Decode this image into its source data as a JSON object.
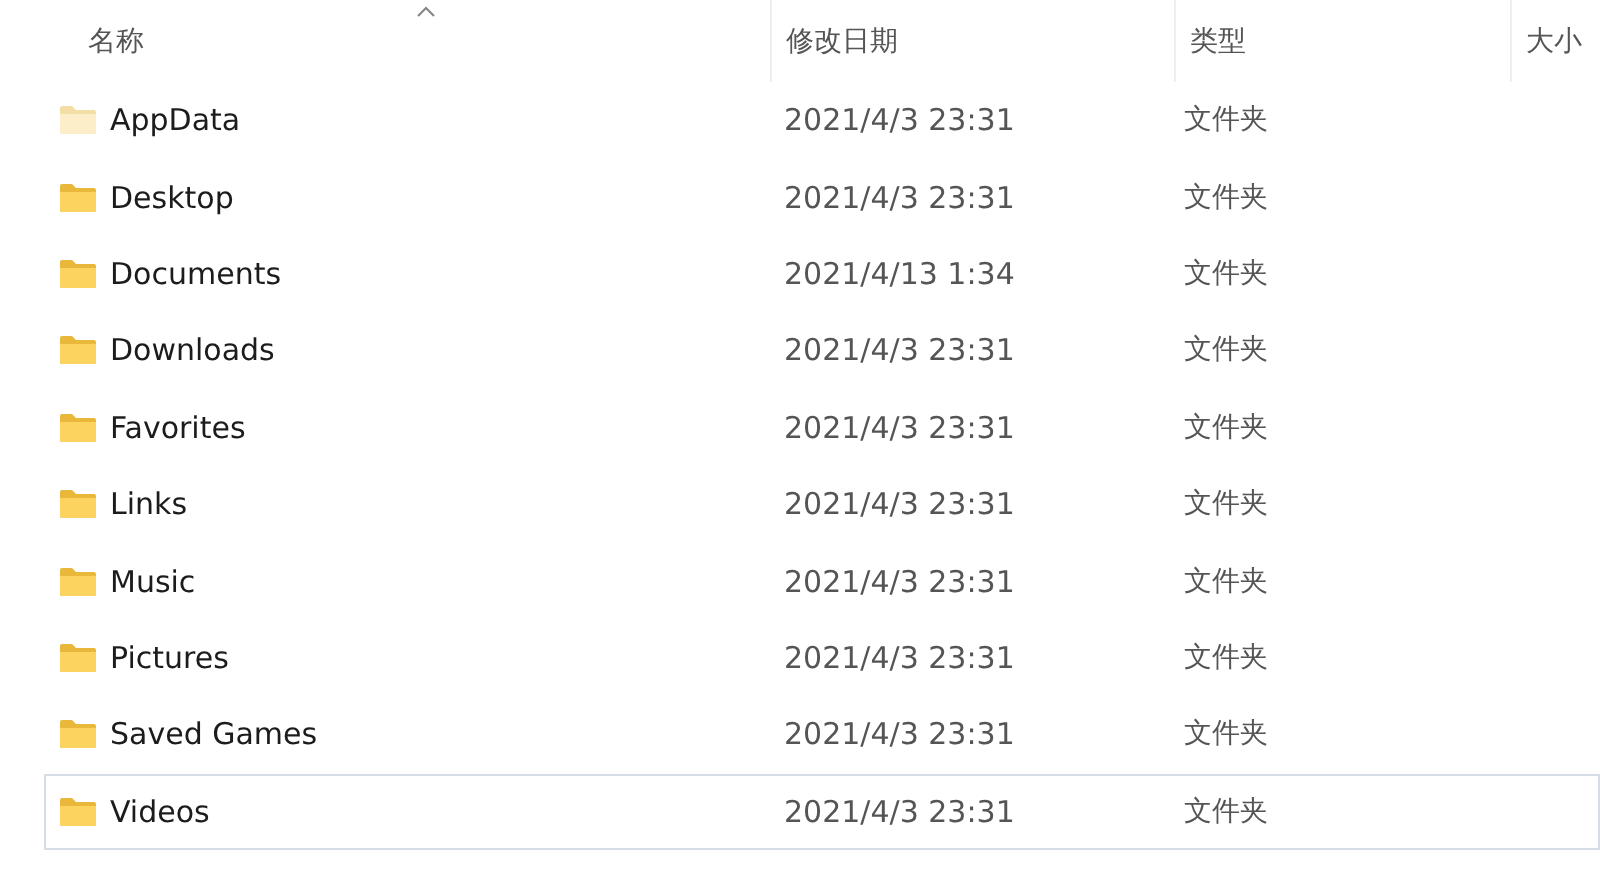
{
  "columns": [
    {
      "label": "名称",
      "sorted": true
    },
    {
      "label": "修改日期",
      "sorted": false
    },
    {
      "label": "类型",
      "sorted": false
    },
    {
      "label": "大小",
      "sorted": false
    }
  ],
  "rows": [
    {
      "name": "AppData",
      "modified": "2021/4/3 23:31",
      "type": "文件夹",
      "hidden": true,
      "focused": false
    },
    {
      "name": "Desktop",
      "modified": "2021/4/3 23:31",
      "type": "文件夹",
      "hidden": false,
      "focused": false
    },
    {
      "name": "Documents",
      "modified": "2021/4/13 1:34",
      "type": "文件夹",
      "hidden": false,
      "focused": false
    },
    {
      "name": "Downloads",
      "modified": "2021/4/3 23:31",
      "type": "文件夹",
      "hidden": false,
      "focused": false
    },
    {
      "name": "Favorites",
      "modified": "2021/4/3 23:31",
      "type": "文件夹",
      "hidden": false,
      "focused": false
    },
    {
      "name": "Links",
      "modified": "2021/4/3 23:31",
      "type": "文件夹",
      "hidden": false,
      "focused": false
    },
    {
      "name": "Music",
      "modified": "2021/4/3 23:31",
      "type": "文件夹",
      "hidden": false,
      "focused": false
    },
    {
      "name": "Pictures",
      "modified": "2021/4/3 23:31",
      "type": "文件夹",
      "hidden": false,
      "focused": false
    },
    {
      "name": "Saved Games",
      "modified": "2021/4/3 23:31",
      "type": "文件夹",
      "hidden": false,
      "focused": false
    },
    {
      "name": "Videos",
      "modified": "2021/4/3 23:31",
      "type": "文件夹",
      "hidden": false,
      "focused": true
    }
  ]
}
